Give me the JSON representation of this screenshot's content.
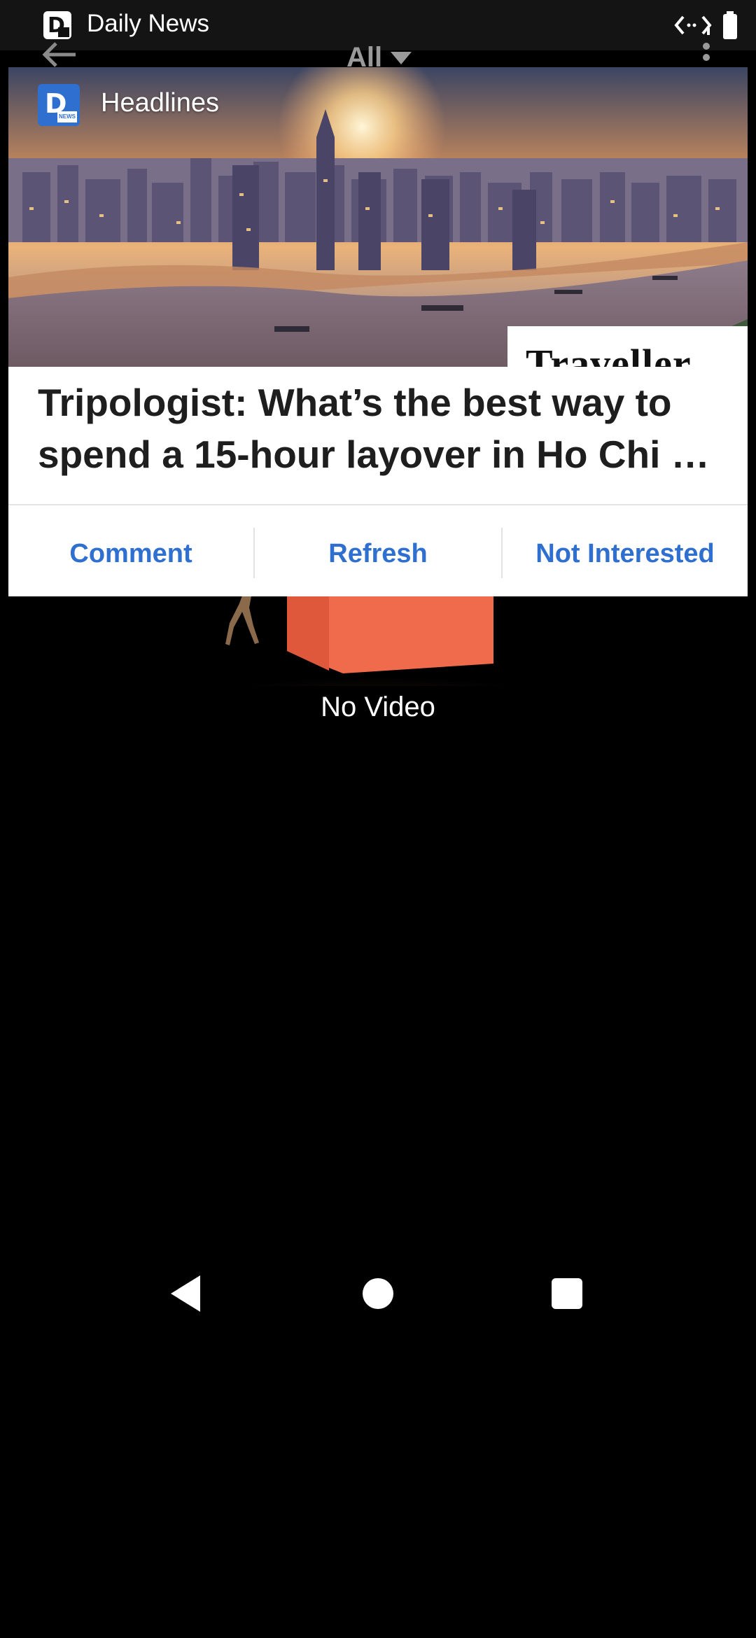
{
  "status_bar": {
    "app_name": "Daily News",
    "right_icons": [
      "code-icon",
      "battery-icon"
    ]
  },
  "toolbar": {
    "filter_label": "All",
    "back_icon": "arrow-left-icon",
    "menu_icon": "more-vert-icon"
  },
  "background": {
    "empty_state_text": "No Video"
  },
  "card": {
    "source_name": "Headlines",
    "image_watermark": "Traveller",
    "headline": "Tripologist: What’s the best way to spend a 15-hour layover in Ho Chi …",
    "actions": {
      "comment": "Comment",
      "refresh": "Refresh",
      "not_interested": "Not Interested"
    }
  },
  "nav_bar": {
    "icons": [
      "nav-back-icon",
      "nav-home-icon",
      "nav-recents-icon"
    ]
  },
  "colors": {
    "accent": "#2e6fd0",
    "background": "#000000",
    "card": "#ffffff",
    "headline_text": "#1e1e1e"
  }
}
